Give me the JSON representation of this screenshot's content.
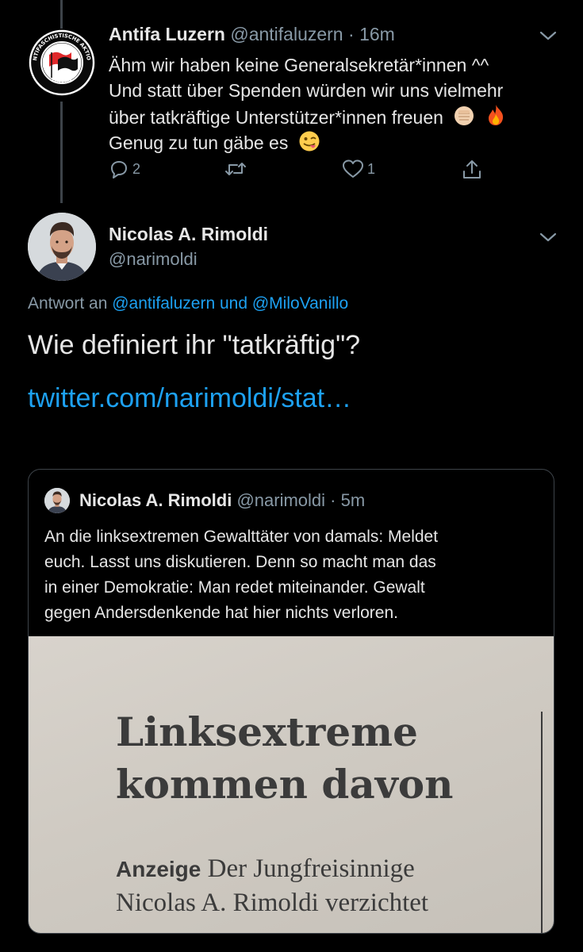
{
  "tweet1": {
    "author_name": "Antifa Luzern",
    "author_handle": "@antifaluzern",
    "separator": "·",
    "time": "16m",
    "avatar_logo_text": "ANTIFASCHISTISCHE AKTION LUZERN",
    "lines": [
      "Ähm wir haben keine Generalsekretär*innen ^^",
      "Und statt über Spenden würden wir uns vielmehr",
      "über tatkräftige Unterstützer*innen freuen",
      "Genug zu tun gäbe es"
    ],
    "emojis": [
      "fist-emoji",
      "fire-emoji",
      "winking-tongue-emoji"
    ],
    "actions": {
      "reply_count": "2",
      "retweet_count": "",
      "like_count": "1"
    }
  },
  "tweet2": {
    "author_name": "Nicolas A. Rimoldi",
    "author_handle": "@narimoldi",
    "reply_prefix": "Antwort an",
    "reply_to_1": "@antifaluzern",
    "reply_joiner": "und",
    "reply_to_2": "@MiloVanillo",
    "text": "Wie definiert ihr \"tatkräftig\"?",
    "link": "twitter.com/narimoldi/stat…"
  },
  "quote": {
    "author_name": "Nicolas A. Rimoldi",
    "author_handle": "@narimoldi",
    "separator": "·",
    "time": "5m",
    "lines": [
      "An die linksextremen Gewalttäter von damals: Meldet",
      "euch. Lasst uns diskutieren. Denn so macht man das",
      "in einer Demokratie: Man redet miteinander. Gewalt",
      "gegen Andersdenkende hat hier nichts verloren."
    ],
    "image": {
      "headline_1": "Linksextreme",
      "headline_2": "kommen davon",
      "body_keyword": "Anzeige",
      "body_line_1": "Der  Jungfreisinnige",
      "body_line_2": "Nicolas A. Rimoldi verzichtet"
    }
  },
  "colors": {
    "background": "#000000",
    "text": "#e6e6e6",
    "muted": "#8899a6",
    "link": "#1da1f2",
    "border": "#3d4349"
  }
}
